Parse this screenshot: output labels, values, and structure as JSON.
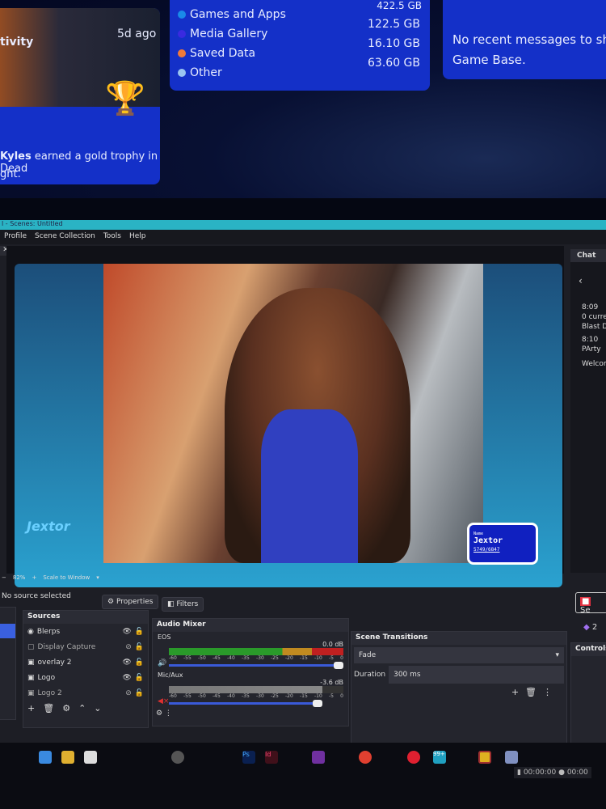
{
  "ps5": {
    "activity": {
      "label": "tivity",
      "time": "5d ago",
      "message_name": "Kyles",
      "message_text": " earned a gold trophy in Dead",
      "message_cont": "ght."
    },
    "storage": {
      "top_value": "422.5 GB",
      "items": [
        {
          "label": "Games and Apps",
          "value": "122.5 GB",
          "color": "#1a8ae8"
        },
        {
          "label": "Media Gallery",
          "value": "16.10 GB",
          "color": "#3a2ae0"
        },
        {
          "label": "Saved Data",
          "value": "63.60 GB",
          "color": "#f07a3a"
        },
        {
          "label": "Other",
          "value": "",
          "color": "#9ac4f0"
        }
      ]
    },
    "messages": {
      "text": "No recent messages to show",
      "text2": "Game Base."
    }
  },
  "obs": {
    "title": "l - Scenes: Untitled",
    "menu": [
      "Profile",
      "Scene Collection",
      "Tools",
      "Help"
    ],
    "overlay": {
      "logo": "Jextor",
      "name_label": "Name",
      "name": "Jextor",
      "score": "5749/6847"
    },
    "zoom": "82%",
    "scale": "Scale to Window",
    "no_source": "No source selected",
    "properties": "Properties",
    "filters": "Filters",
    "sources": {
      "title": "Sources",
      "items": [
        {
          "label": "Blerps",
          "visible": true
        },
        {
          "label": "Display Capture",
          "visible": false
        },
        {
          "label": "overlay 2",
          "visible": true
        },
        {
          "label": "Logo",
          "visible": true
        },
        {
          "label": "Logo 2",
          "visible": false
        }
      ]
    },
    "mixer": {
      "title": "Audio Mixer",
      "channels": [
        {
          "name": "EOS",
          "db": "0.0 dB",
          "level": 1.0,
          "muted": false
        },
        {
          "name": "Mic/Aux",
          "db": "-3.6 dB",
          "level": 0.88,
          "muted": true
        }
      ],
      "scale": [
        "-60",
        "-55",
        "-50",
        "-45",
        "-40",
        "-35",
        "-30",
        "-25",
        "-20",
        "-15",
        "-10",
        "-5",
        "0"
      ]
    },
    "transitions": {
      "title": "Scene Transitions",
      "type": "Fade",
      "duration_label": "Duration",
      "duration": "300 ms"
    },
    "controls": {
      "title": "Controls"
    },
    "chat": {
      "title": "Chat",
      "messages": [
        {
          "time": "8:09",
          "line1": "0 curre",
          "line2": "Blast D"
        },
        {
          "time": "8:10",
          "line1": "PArty"
        },
        {
          "line1": "Welcom"
        }
      ]
    },
    "record_label": "Se",
    "viewer_count": "2",
    "status": {
      "time1": "00:00:00",
      "time2": "00:00"
    },
    "taskbar_badge": "99+"
  }
}
